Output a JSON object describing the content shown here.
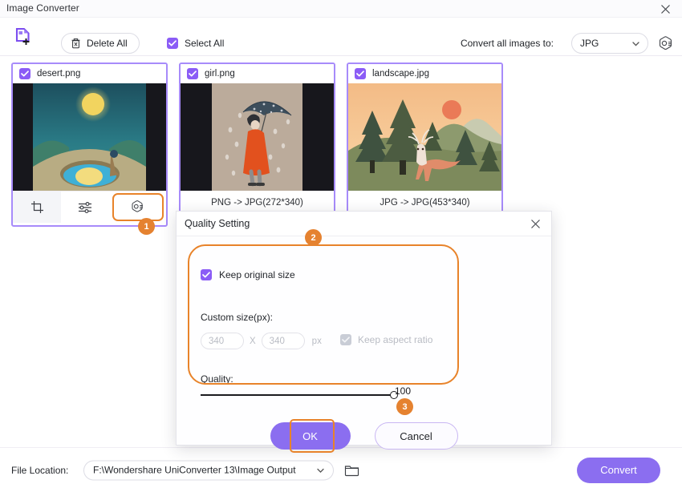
{
  "window": {
    "title": "Image Converter",
    "close_icon": "close-icon"
  },
  "toolbar": {
    "add_file_icon": "add-file-icon",
    "delete_all_label": "Delete All",
    "delete_all_icon": "trash-icon",
    "select_all_label": "Select All",
    "select_all_checked": true,
    "convert_to_label": "Convert all images to:",
    "format_value": "JPG",
    "format_caret": "chevron-down-icon",
    "settings_icon": "settings-gear-icon"
  },
  "cards": [
    {
      "filename": "desert.png",
      "checked": true,
      "caption": "",
      "tools": {
        "crop_icon": "crop-icon",
        "adjust_icon": "adjust-sliders-icon",
        "quality_icon": "camera-quality-icon"
      }
    },
    {
      "filename": "girl.png",
      "checked": true,
      "caption": "PNG -> JPG(272*340)"
    },
    {
      "filename": "landscape.jpg",
      "checked": true,
      "caption": "JPG -> JPG(453*340)"
    }
  ],
  "steps": {
    "one": "1",
    "two": "2",
    "three": "3"
  },
  "dialog": {
    "title": "Quality Setting",
    "close_icon": "close-icon",
    "keep_original_size_label": "Keep original size",
    "keep_original_size_checked": true,
    "custom_size_label": "Custom size(px):",
    "width_value": "340",
    "height_value": "340",
    "multiply_symbol": "X",
    "px_label": "px",
    "keep_aspect_ratio_label": "Keep aspect ratio",
    "keep_aspect_ratio_checked": true,
    "quality_label": "Quality:",
    "quality_value": "100",
    "ok_label": "OK",
    "cancel_label": "Cancel"
  },
  "bottom": {
    "file_location_label": "File Location:",
    "file_location_value": "F:\\Wondershare UniConverter 13\\Image Output",
    "file_location_caret": "chevron-down-icon",
    "folder_icon": "folder-icon",
    "convert_label": "Convert"
  },
  "colors": {
    "accent_purple": "#8b6ef0",
    "card_border": "#a78bfa",
    "highlight_orange": "#e8832a",
    "checkbox_purple": "#8b5cf6"
  }
}
